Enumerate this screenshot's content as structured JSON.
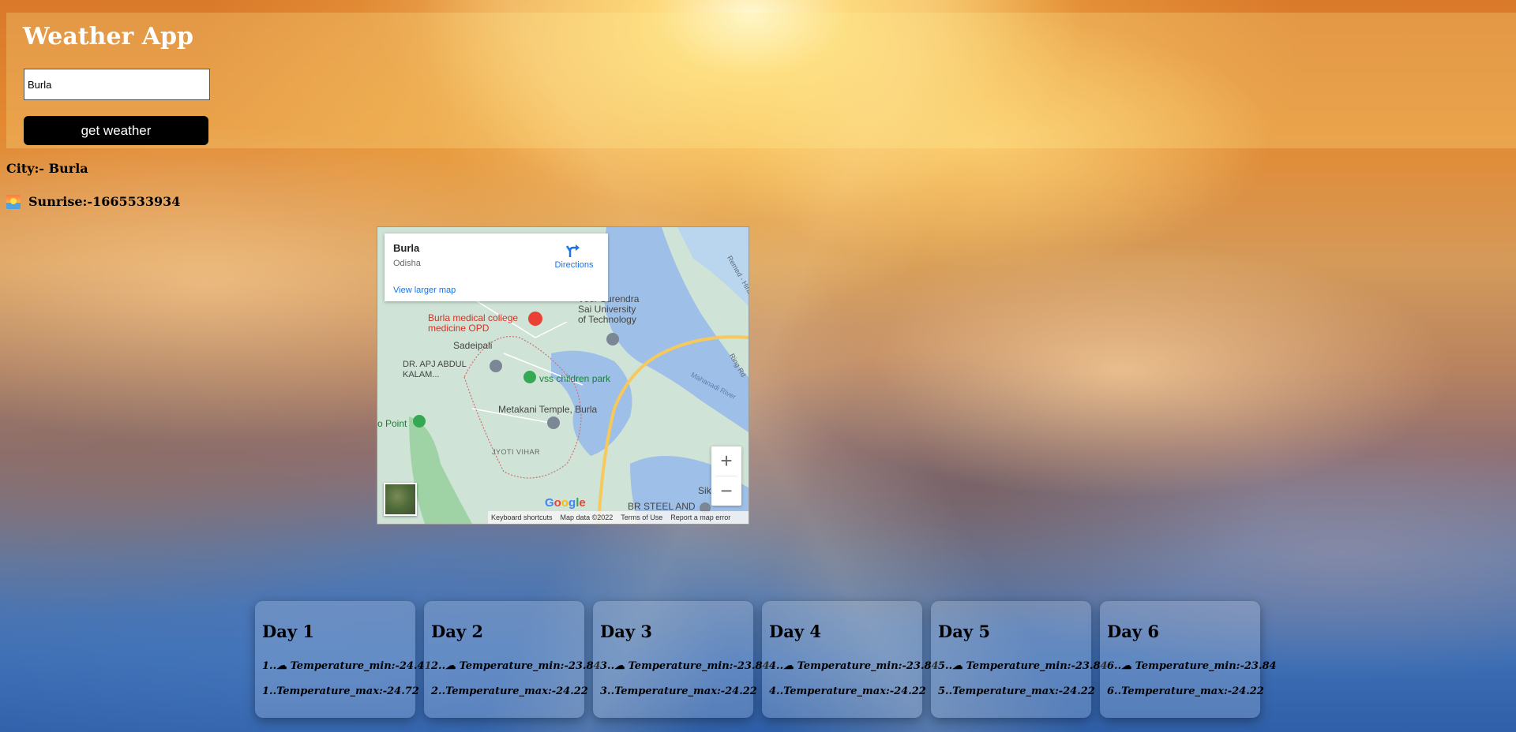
{
  "app": {
    "title": "Weather App"
  },
  "search": {
    "value": "Burla",
    "button_label": "get weather"
  },
  "info": {
    "city_text": "City:- Burla",
    "sunrise_icon": "sunrise-icon",
    "sunrise_text": "Sunrise:-1665533934"
  },
  "map": {
    "place_name": "Burla",
    "region": "Odisha",
    "directions_label": "Directions",
    "larger_map_label": "View larger map",
    "labels": {
      "medical": "Burla medical college\nmedicine OPD",
      "university": "Veer Surendra\nSai University\nof Technology",
      "sadeipali": "Sadeipali",
      "apj": "DR. APJ ABDUL\nKALAM...",
      "park": "vss children park",
      "temple": "Metakani Temple, Burla",
      "point": "o Point",
      "jyoti": "JYOTI VIHAR",
      "mahanadi": "Mahanadi River",
      "remed": "Remed - Hira",
      "ring": "Ring Rd",
      "steel": "BR STEEL AND",
      "sik": "Sik"
    },
    "zoom_in": "+",
    "zoom_out": "−",
    "google_logo": "Google",
    "footer": {
      "shortcuts": "Keyboard shortcuts",
      "data": "Map data ©2022",
      "terms": "Terms of Use",
      "report": "Report a map error"
    },
    "colors": {
      "water": "#9ec0e8",
      "land": "#cfe3d6",
      "forest": "#9fd3a5",
      "road": "#f7c95a",
      "link": "#1a73e8"
    }
  },
  "forecast": {
    "cloud_icon": "cloud-icon",
    "days": [
      {
        "title": "Day 1",
        "min": "1..☁ Temperature_min:-24.41",
        "max": "1..Temperature_max:-24.72"
      },
      {
        "title": "Day 2",
        "min": "2..☁ Temperature_min:-23.84",
        "max": "2..Temperature_max:-24.22"
      },
      {
        "title": "Day 3",
        "min": "3..☁ Temperature_min:-23.84",
        "max": "3..Temperature_max:-24.22"
      },
      {
        "title": "Day 4",
        "min": "4..☁ Temperature_min:-23.84",
        "max": "4..Temperature_max:-24.22"
      },
      {
        "title": "Day 5",
        "min": "5..☁ Temperature_min:-23.84",
        "max": "5..Temperature_max:-24.22"
      },
      {
        "title": "Day 6",
        "min": "6..☁ Temperature_min:-23.84",
        "max": "6..Temperature_max:-24.22"
      }
    ]
  }
}
